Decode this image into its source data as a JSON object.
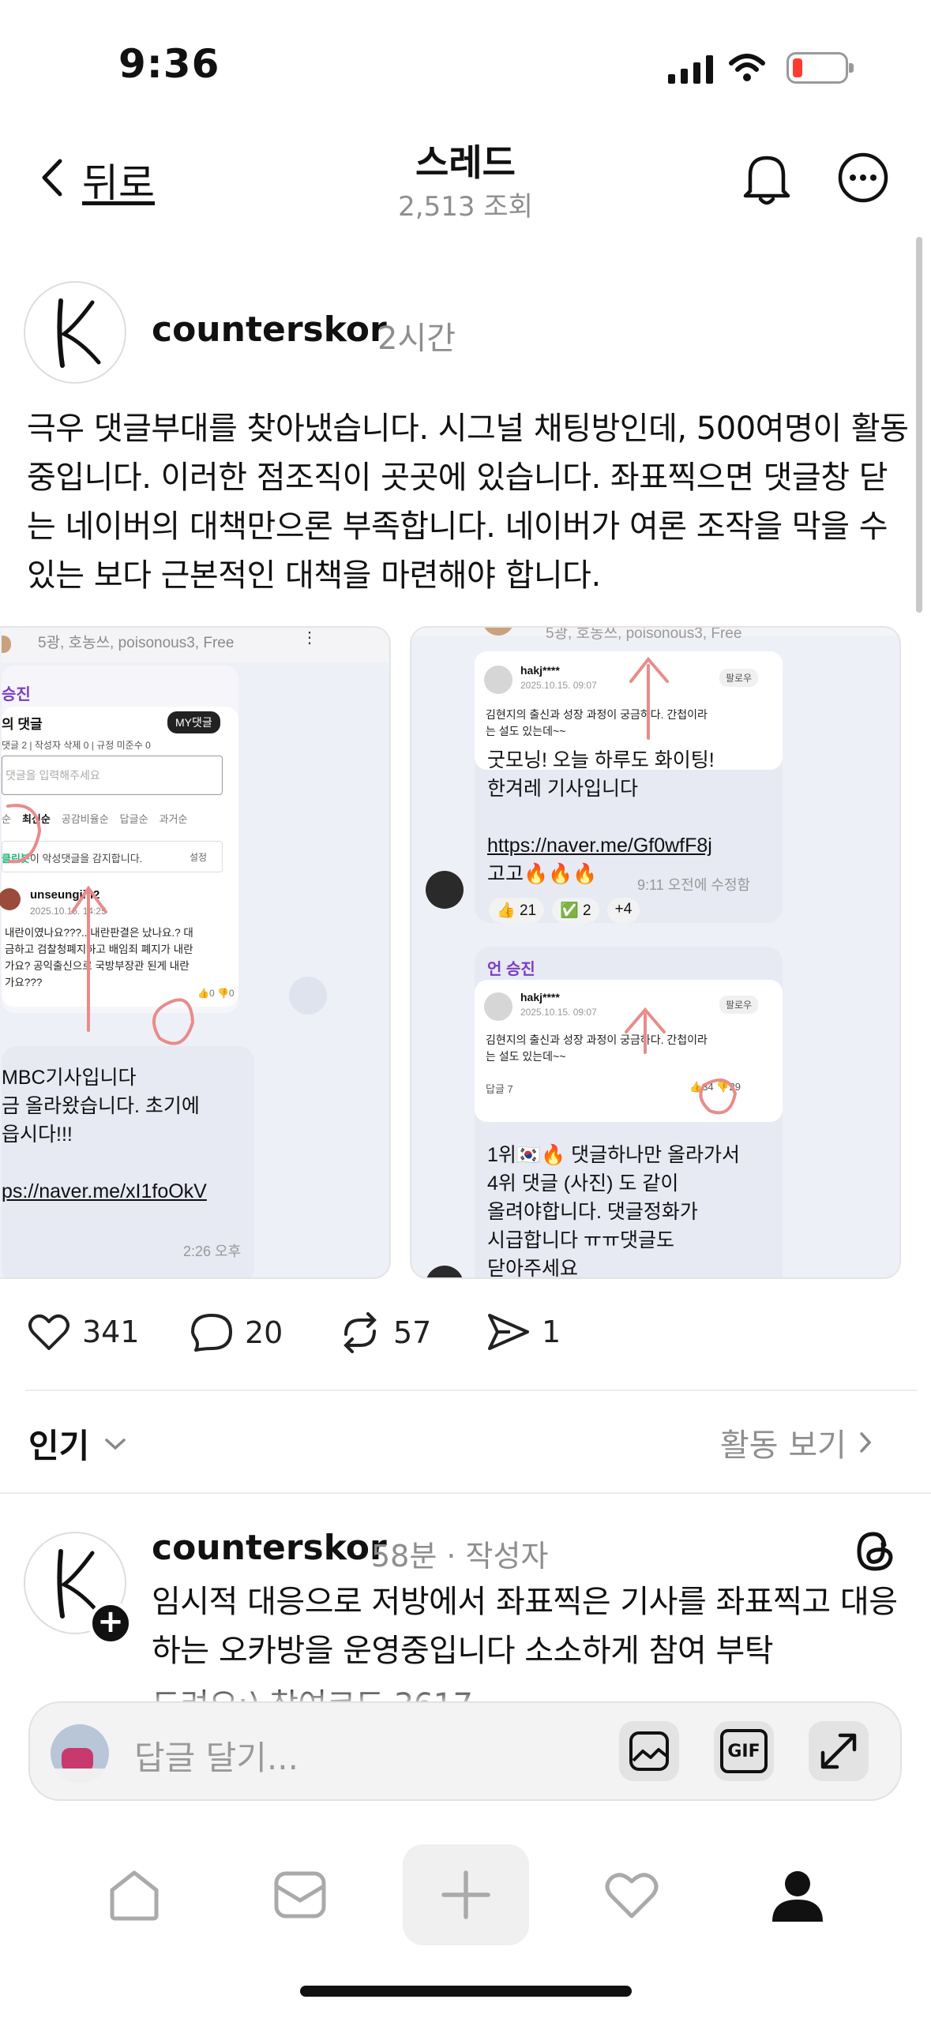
{
  "status_bar": {
    "time": "9:36"
  },
  "header": {
    "back_label": "뒤로",
    "title": "스레드",
    "views": "2,513 조회"
  },
  "post": {
    "author": "counterskor",
    "time": "2시간",
    "body": "극우 댓글부대를 찾아냈습니다. 시그널 채팅방인데, 500여명이 활동 중입니다. 이러한 점조직이 곳곳에 있습니다. 좌표찍으면 댓글창 닫는 네이버의 대책만으론 부족합니다. 네이버가 여론 조작을 막을 수 있는 보다 근본적인 대책을 마련해야 합니다.",
    "avatar_letter": "K"
  },
  "left_image": {
    "group_line": "5광, 호농쓰, poisonous3, Free",
    "section_label": "승진",
    "comments_title": "의 댓글",
    "my_comments": "MY댓글",
    "stats": "댓글 2  |  작성자 삭제 0  |  규정 미준수 0",
    "input_placeholder": "댓글을 입력해주세요",
    "sort_tabs": [
      "순",
      "최신순",
      "공감비율순",
      "답글순",
      "과거순"
    ],
    "cleanbot_name": "클린봇",
    "cleanbot_text": "이 악성댓글을 감지합니다.",
    "settings": "설정",
    "commenter": "unseungjin2",
    "comment_date": "2025.10.15. 14:25",
    "comment_lines": [
      "내란이였나요???.. 내란판결은 났나요.? 대",
      "금하고 검찰청폐지하고 배임죄 폐지가 내란",
      "가요? 공익출신으로 국방부장관 된게 내란",
      "가요???"
    ],
    "likes": "0",
    "dislikes": "0",
    "message_lines": [
      "MBC기사입니다",
      "금 올라왔습니다. 초기에",
      "읍시다!!!",
      "",
      "ps://naver.me/xI1foOkV"
    ],
    "message_time": "2:26 오후"
  },
  "right_image": {
    "group_line": "5광, 호농쓰, poisonous3, Free",
    "card1": {
      "user": "hakj****",
      "date": "2025.10.15. 09:07",
      "follow": "팔로우",
      "text_lines": [
        "김현지의 출신과 성장 과정이 궁금하다. 간첩이라",
        "는 설도 있는데~~"
      ]
    },
    "message1_lines": [
      "굿모닝! 오늘 하루도 화이팅!",
      "한겨레 기사입니다",
      "",
      "https://naver.me/Gf0wfF8j",
      "고고🔥🔥🔥"
    ],
    "message1_time": "9:11 오전에 수정함",
    "reactions": [
      {
        "emoji": "👍",
        "count": "21"
      },
      {
        "emoji": "✅",
        "count": "2"
      },
      {
        "emoji": "",
        "count": "+4"
      }
    ],
    "sender_label": "언 승진",
    "card2": {
      "user": "hakj****",
      "date": "2025.10.15. 09:07",
      "follow": "팔로우",
      "text_lines": [
        "김현지의 출신과 성장 과정이 궁금하다. 간첩이라",
        "는 설도 있는데~~"
      ],
      "replies": "답글 7",
      "likes": "34",
      "dislikes": "29"
    },
    "message2_lines": [
      "1위🇰🇷🔥 댓글하나만 올라가서",
      "4위 댓글 (사진) 도 같이",
      "올려야합니다. 댓글정화가",
      "시급합니다 ㅠㅠ댓글도",
      "닫아주세요"
    ]
  },
  "actions": {
    "likes": "341",
    "comments": "20",
    "reposts": "57",
    "shares": "1"
  },
  "replies_bar": {
    "sort_label": "인기",
    "activity_label": "활동 보기"
  },
  "reply": {
    "author": "counterskor",
    "meta": "58분 · 작성자",
    "body": "임시적 대응으로 저방에서 좌표찍은 기사를 좌표찍고 대응하는 오카방을 운영중입니다 소소하게 참여 부탁",
    "body_cut": "드려요:) 참여코드 3617"
  },
  "composer": {
    "placeholder": "답글 달기...",
    "gif_label": "GIF"
  },
  "colors": {
    "annotation_red": "#e98b8b",
    "bubble": "#e7e9f3",
    "accent_purple": "#7a3cc8"
  }
}
